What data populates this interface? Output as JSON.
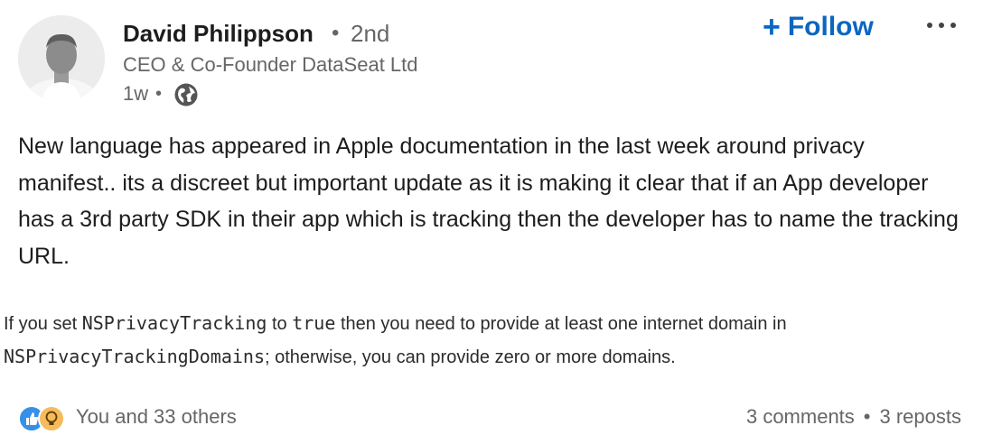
{
  "author": {
    "name": "David Philippson",
    "degree": "2nd",
    "headline": "CEO & Co-Founder DataSeat Ltd",
    "timestamp": "1w",
    "visibility_icon": "globe-icon"
  },
  "actions": {
    "follow_label": "Follow",
    "follow_icon": "plus-icon",
    "more_icon": "more-icon"
  },
  "post": {
    "text": "New language has appeared in Apple documentation in the last week around privacy manifest.. its a discreet but important update as it is making it clear that if an App developer has a 3rd party SDK in their app which is tracking then the developer has to name the tracking URL."
  },
  "excerpt": {
    "line1_prefix": "If you set ",
    "line1_code1": "NSPrivacyTracking",
    "line1_mid": " to ",
    "line1_code2": "true",
    "line1_suffix": " then you need to provide at least one internet domain in",
    "line2_code": "NSPrivacyTrackingDomains",
    "line2_suffix": "; otherwise, you can provide zero or more domains."
  },
  "social": {
    "reaction_icons": [
      "like-icon",
      "insightful-icon"
    ],
    "reactions_text": "You and 33 others",
    "comments": "3 comments",
    "separator": "•",
    "reposts": "3 reposts"
  },
  "colors": {
    "accent": "#0a66c2",
    "like": "#378fe9",
    "insightful": "#f5bb5c"
  }
}
